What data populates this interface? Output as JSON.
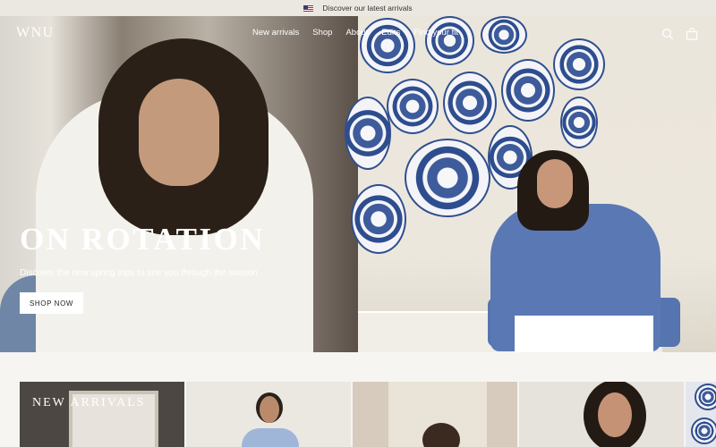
{
  "announcement": {
    "text": "Discover our latest arrivals",
    "flag_icon": "us-flag-icon"
  },
  "header": {
    "logo": "WNU",
    "nav": [
      "New arrivals",
      "Shop",
      "About",
      "Edits",
      "Find your fit"
    ],
    "icons": [
      "search-icon",
      "bag-icon"
    ]
  },
  "hero": {
    "title": "ON ROTATION",
    "subtitle": "Discover the new spring tops to see you through the season",
    "cta": "SHOP NOW"
  },
  "categories": {
    "first_title": "NEW ARRIVALS"
  },
  "colors": {
    "announcement_bg": "#ebe8e1",
    "page_bg": "#f6f5f1",
    "plate_blue": "#2f4f8f",
    "shirt_blue": "#5a78b4"
  }
}
